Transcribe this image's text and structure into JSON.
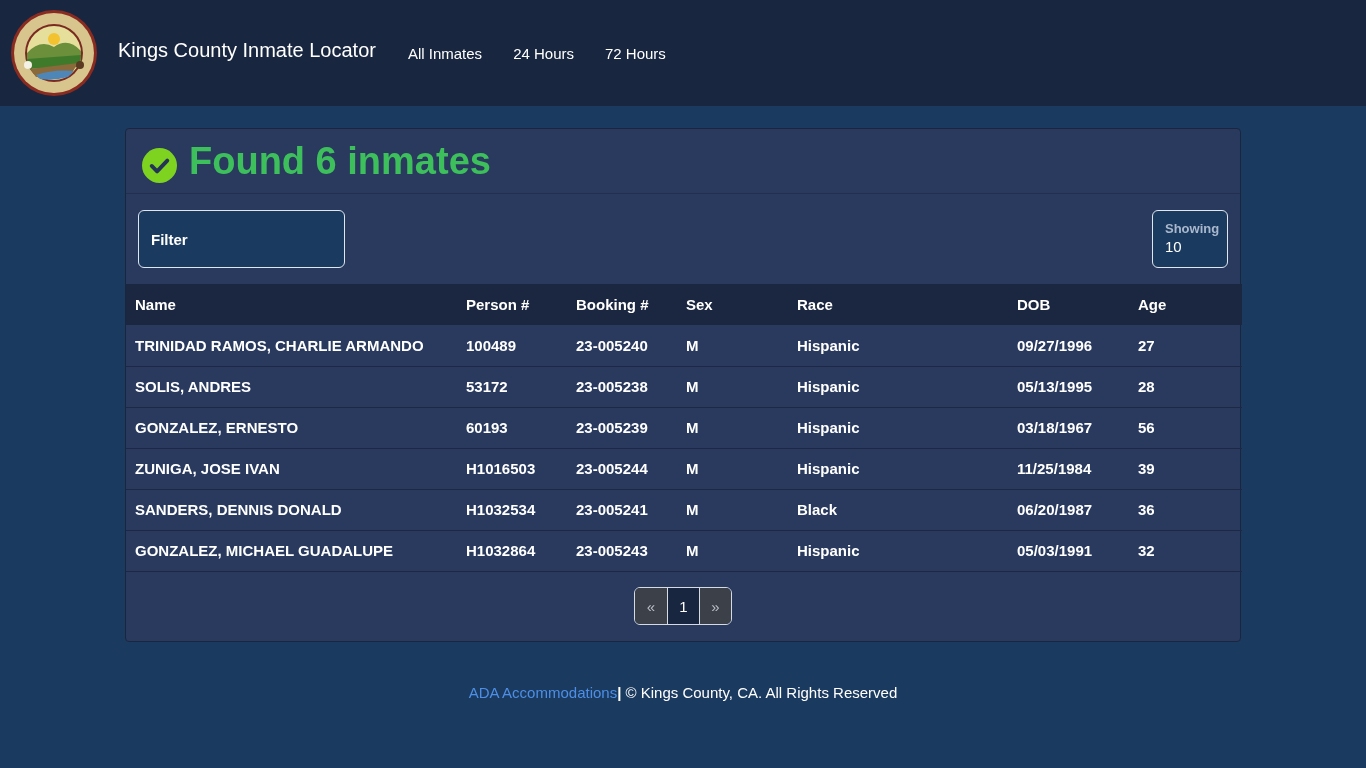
{
  "header": {
    "title": "Kings County Inmate Locator",
    "nav": [
      {
        "label": "All Inmates"
      },
      {
        "label": "24 Hours"
      },
      {
        "label": "72 Hours"
      }
    ]
  },
  "results": {
    "heading": "Found 6 inmates",
    "filter": {
      "placeholder": "Filter"
    },
    "showing": {
      "label": "Showing",
      "value": "10"
    }
  },
  "table": {
    "columns": [
      "Name",
      "Person #",
      "Booking #",
      "Sex",
      "Race",
      "DOB",
      "Age"
    ],
    "rows": [
      [
        "TRINIDAD RAMOS, CHARLIE ARMANDO",
        "100489",
        "23-005240",
        "M",
        "Hispanic",
        "09/27/1996",
        "27"
      ],
      [
        "SOLIS, ANDRES",
        "53172",
        "23-005238",
        "M",
        "Hispanic",
        "05/13/1995",
        "28"
      ],
      [
        "GONZALEZ, ERNESTO",
        "60193",
        "23-005239",
        "M",
        "Hispanic",
        "03/18/1967",
        "56"
      ],
      [
        "ZUNIGA, JOSE IVAN",
        "H1016503",
        "23-005244",
        "M",
        "Hispanic",
        "11/25/1984",
        "39"
      ],
      [
        "SANDERS, DENNIS DONALD",
        "H1032534",
        "23-005241",
        "M",
        "Black",
        "06/20/1987",
        "36"
      ],
      [
        "GONZALEZ, MICHAEL GUADALUPE",
        "H1032864",
        "23-005243",
        "M",
        "Hispanic",
        "05/03/1991",
        "32"
      ]
    ]
  },
  "pagination": {
    "prev": "«",
    "pages": [
      {
        "label": "1",
        "selected": true
      }
    ],
    "next": "»"
  },
  "footer": {
    "link": "ADA Accommodations",
    "text": "**|** © Kings County, CA. All Rights Reserved"
  }
}
